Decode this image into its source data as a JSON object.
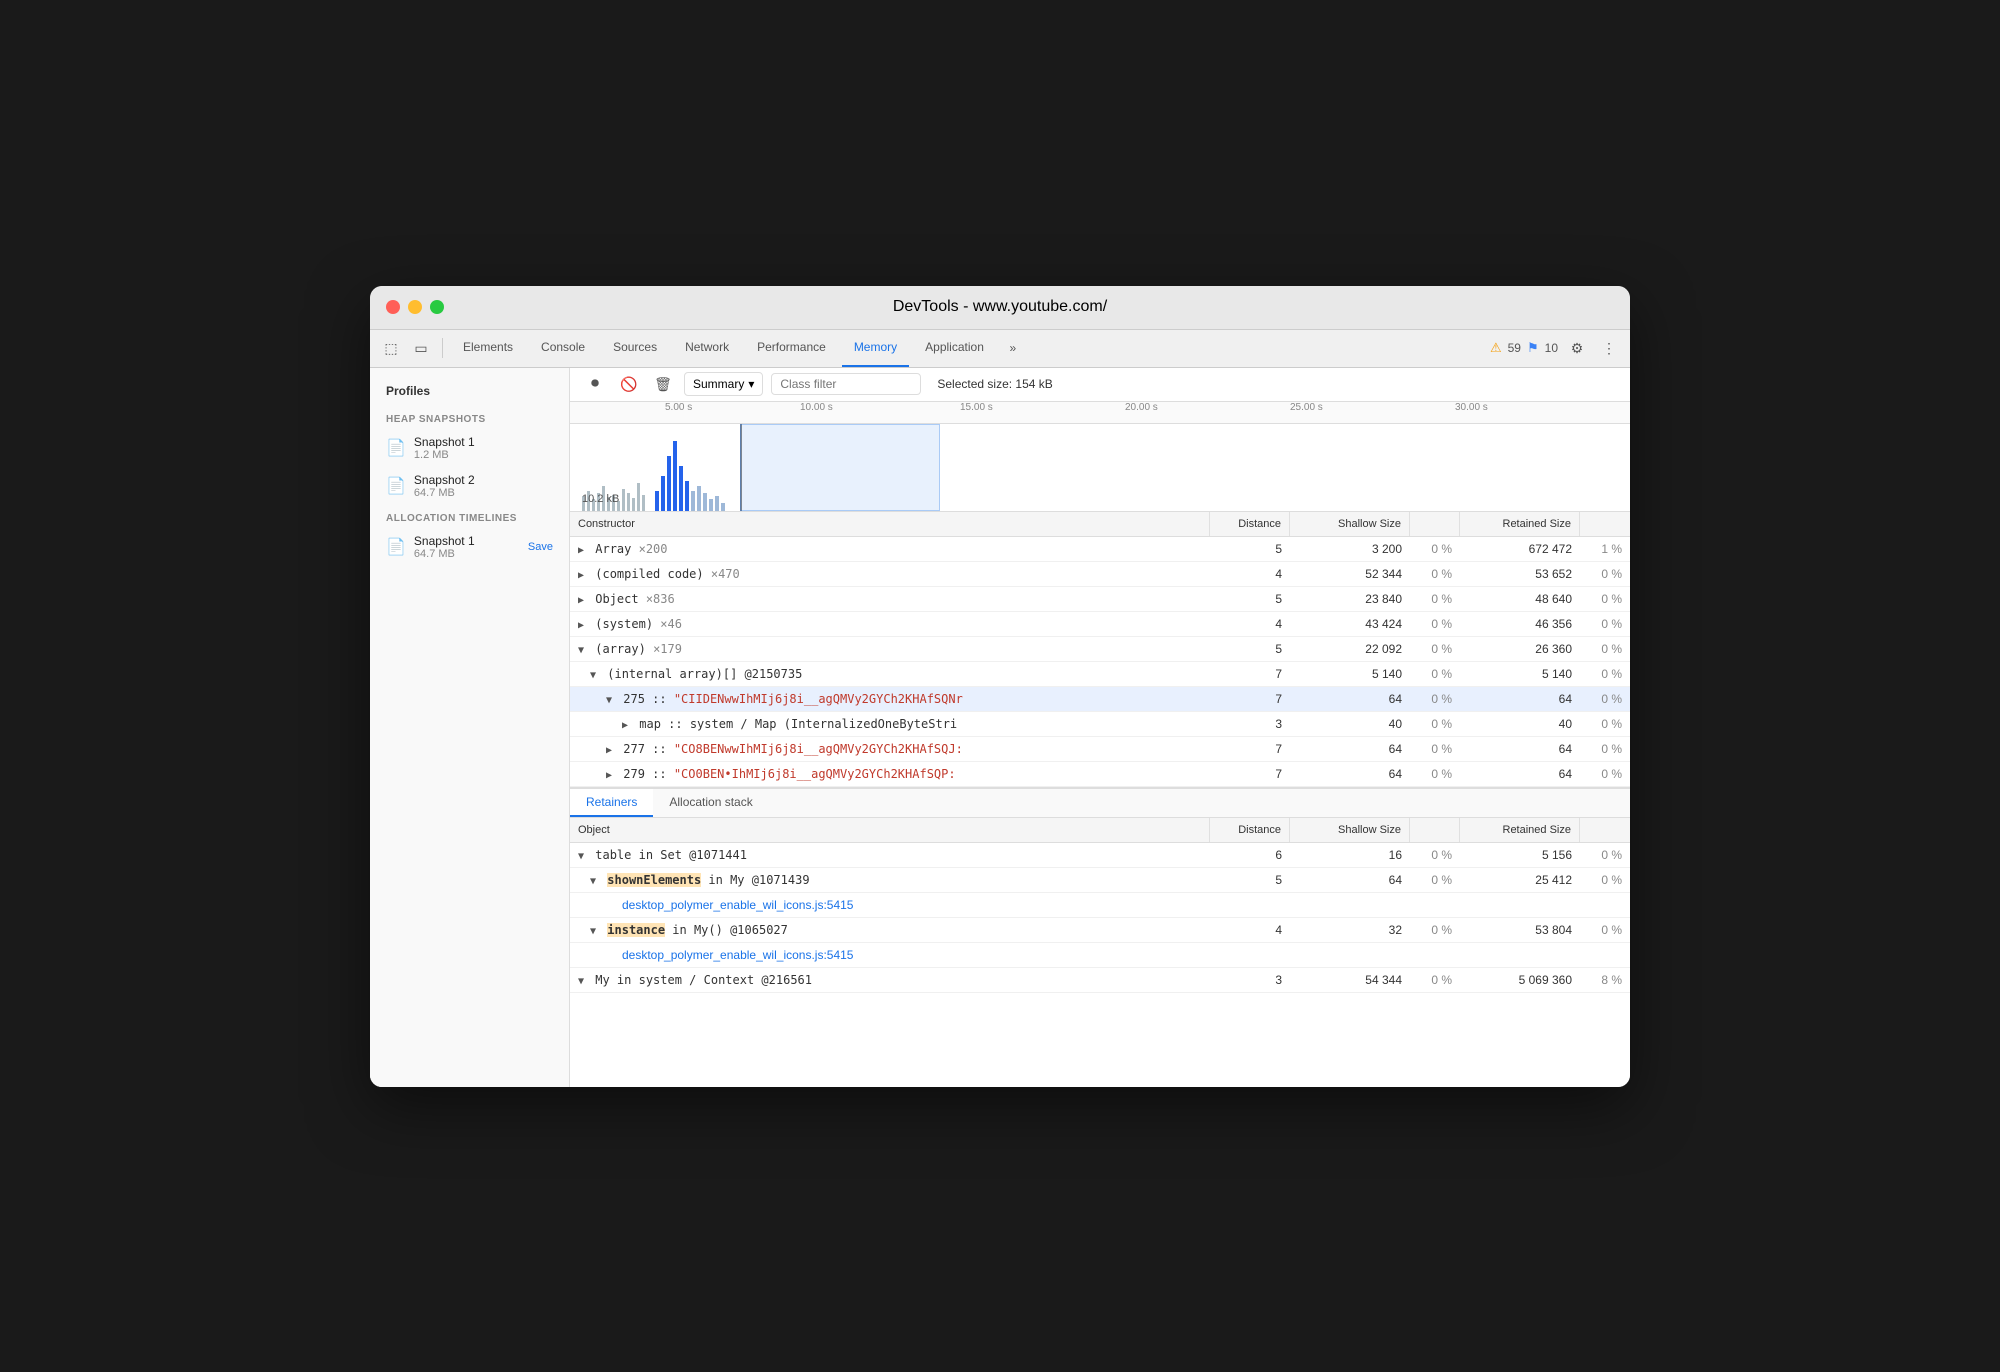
{
  "window": {
    "title": "DevTools - www.youtube.com/"
  },
  "toolbar": {
    "tabs": [
      {
        "label": "Elements",
        "active": false
      },
      {
        "label": "Console",
        "active": false
      },
      {
        "label": "Sources",
        "active": false
      },
      {
        "label": "Network",
        "active": false
      },
      {
        "label": "Performance",
        "active": false
      },
      {
        "label": "Memory",
        "active": true
      },
      {
        "label": "Application",
        "active": false
      }
    ],
    "warning_count": "59",
    "info_count": "10"
  },
  "subtoolbar": {
    "summary_label": "Summary",
    "class_filter_placeholder": "Class filter",
    "selected_size": "Selected size: 154 kB"
  },
  "timeline": {
    "ruler_marks": [
      "5.00 s",
      "10.00 s",
      "15.00 s",
      "20.00 s",
      "25.00 s",
      "30.00 s"
    ],
    "label": "10.2 kB"
  },
  "table": {
    "headers": [
      "Constructor",
      "Distance",
      "Shallow Size",
      "",
      "Retained Size",
      ""
    ],
    "rows": [
      {
        "indent": 0,
        "expand": true,
        "expanded": false,
        "name": "Array",
        "count": "×200",
        "distance": "5",
        "shallow": "3 200",
        "shallow_pct": "0 %",
        "retained": "672 472",
        "retained_pct": "1 %"
      },
      {
        "indent": 0,
        "expand": true,
        "expanded": false,
        "name": "(compiled code)",
        "count": "×470",
        "distance": "4",
        "shallow": "52 344",
        "shallow_pct": "0 %",
        "retained": "53 652",
        "retained_pct": "0 %"
      },
      {
        "indent": 0,
        "expand": true,
        "expanded": false,
        "name": "Object",
        "count": "×836",
        "distance": "5",
        "shallow": "23 840",
        "shallow_pct": "0 %",
        "retained": "48 640",
        "retained_pct": "0 %"
      },
      {
        "indent": 0,
        "expand": true,
        "expanded": false,
        "name": "(system)",
        "count": "×46",
        "distance": "4",
        "shallow": "43 424",
        "shallow_pct": "0 %",
        "retained": "46 356",
        "retained_pct": "0 %"
      },
      {
        "indent": 0,
        "expand": true,
        "expanded": true,
        "name": "(array)",
        "count": "×179",
        "distance": "5",
        "shallow": "22 092",
        "shallow_pct": "0 %",
        "retained": "26 360",
        "retained_pct": "0 %"
      },
      {
        "indent": 1,
        "expand": true,
        "expanded": true,
        "name": "(internal array)[] @2150735",
        "count": "",
        "distance": "7",
        "shallow": "5 140",
        "shallow_pct": "0 %",
        "retained": "5 140",
        "retained_pct": "0 %"
      },
      {
        "indent": 2,
        "expand": true,
        "expanded": true,
        "name": "275 :: ",
        "name_red": "\"CIIDENwwIhMIj6j8i__agQMVy2GYCh2KHAfSQNr",
        "count": "",
        "distance": "7",
        "shallow": "64",
        "shallow_pct": "0 %",
        "retained": "64",
        "retained_pct": "0 %"
      },
      {
        "indent": 3,
        "expand": true,
        "expanded": false,
        "name": "map :: system / Map (InternalizedOneByteStri",
        "count": "",
        "distance": "3",
        "shallow": "40",
        "shallow_pct": "0 %",
        "retained": "40",
        "retained_pct": "0 %"
      },
      {
        "indent": 2,
        "expand": true,
        "expanded": false,
        "name": "277 :: ",
        "name_red": "\"CO8BENwwIhMIj6j8i__agQMVy2GYCh2KHAfSQJ:",
        "count": "",
        "distance": "7",
        "shallow": "64",
        "shallow_pct": "0 %",
        "retained": "64",
        "retained_pct": "0 %"
      },
      {
        "indent": 2,
        "expand": true,
        "expanded": false,
        "name": "279 :: ",
        "name_red": "\"COoBEN•IhMIj6j8i__agQMVy2GYCh2KHAfSQP:",
        "count": "",
        "distance": "7",
        "shallow": "64",
        "shallow_pct": "0 %",
        "retained": "64",
        "retained_pct": "0 %"
      }
    ]
  },
  "bottom": {
    "tabs": [
      {
        "label": "Retainers",
        "active": true
      },
      {
        "label": "Allocation stack",
        "active": false
      }
    ],
    "headers": [
      "Object",
      "Distance",
      "Shallow Size",
      "",
      "Retained Size",
      ""
    ],
    "rows": [
      {
        "indent": 0,
        "expand": true,
        "text": "table in Set @1071441",
        "distance": "6",
        "shallow": "16",
        "shallow_pct": "0 %",
        "retained": "5 156",
        "retained_pct": "0 %"
      },
      {
        "indent": 1,
        "expand": true,
        "highlight": "shownElements",
        "text": " in My @1071439",
        "distance": "5",
        "shallow": "64",
        "shallow_pct": "0 %",
        "retained": "25 412",
        "retained_pct": "0 %"
      },
      {
        "indent": 2,
        "expand": false,
        "link": "desktop_polymer_enable_wil_icons.js:5415",
        "distance": "",
        "shallow": "",
        "shallow_pct": "",
        "retained": "",
        "retained_pct": ""
      },
      {
        "indent": 1,
        "expand": true,
        "highlight": "instance",
        "text": " in My() @1065027",
        "distance": "4",
        "shallow": "32",
        "shallow_pct": "0 %",
        "retained": "53 804",
        "retained_pct": "0 %"
      },
      {
        "indent": 2,
        "expand": false,
        "link": "desktop_polymer_enable_wil_icons.js:5415",
        "distance": "",
        "shallow": "",
        "shallow_pct": "",
        "retained": "",
        "retained_pct": ""
      },
      {
        "indent": 0,
        "expand": true,
        "text": "My in system / Context @216561",
        "distance": "3",
        "shallow": "54 344",
        "shallow_pct": "0 %",
        "retained": "5 069 360",
        "retained_pct": "8 %"
      }
    ]
  },
  "sidebar": {
    "title": "Profiles",
    "heap_section": "HEAP SNAPSHOTS",
    "snapshots": [
      {
        "name": "Snapshot 1",
        "size": "1.2 MB"
      },
      {
        "name": "Snapshot 2",
        "size": "64.7 MB"
      }
    ],
    "alloc_section": "ALLOCATION TIMELINES",
    "alloc_snapshots": [
      {
        "name": "Snapshot 1",
        "size": "64.7 MB",
        "save_label": "Save"
      }
    ]
  }
}
